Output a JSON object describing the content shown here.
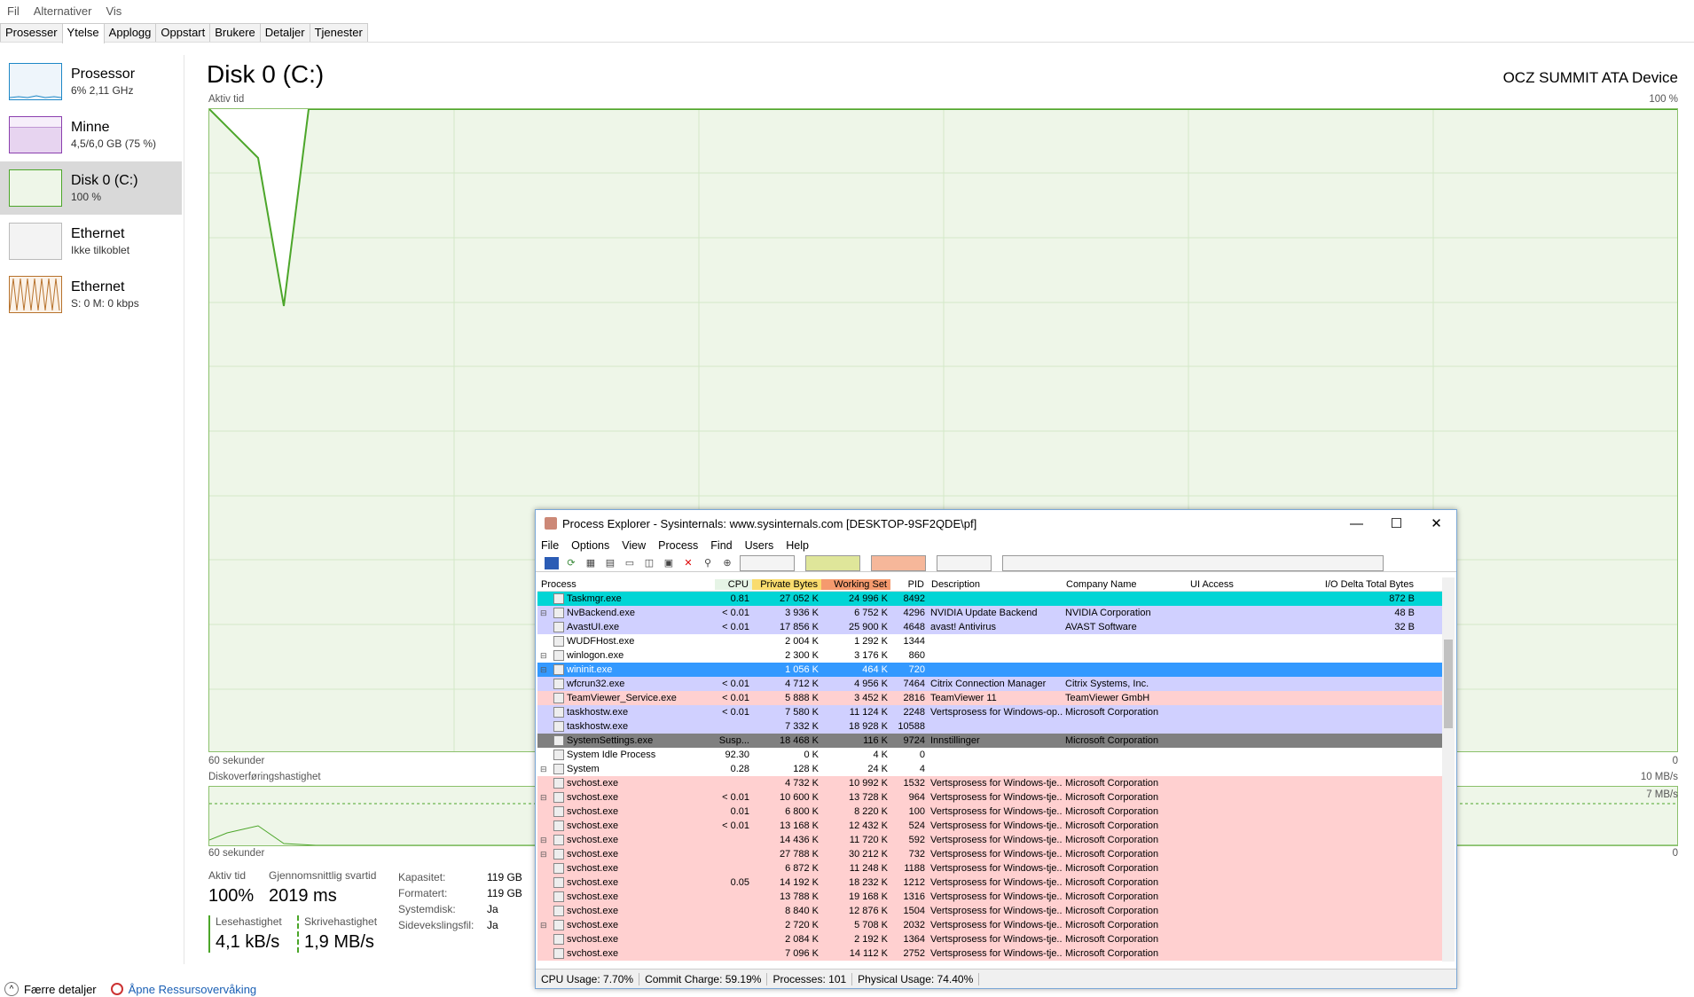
{
  "menubar": {
    "items": [
      "Fil",
      "Alternativer",
      "Vis"
    ]
  },
  "tabs": [
    "Prosesser",
    "Ytelse",
    "Applogg",
    "Oppstart",
    "Brukere",
    "Detaljer",
    "Tjenester"
  ],
  "sidebar": {
    "items": [
      {
        "name": "Prosessor",
        "sub": "6% 2,11 GHz",
        "color": "#1e88c7"
      },
      {
        "name": "Minne",
        "sub": "4,5/6,0 GB (75 %)",
        "color": "#8b3fae"
      },
      {
        "name": "Disk 0 (C:)",
        "sub": "100 %",
        "color": "#4ca62a"
      },
      {
        "name": "Ethernet",
        "sub": "Ikke tilkoblet",
        "color": "#aaaaaa"
      },
      {
        "name": "Ethernet",
        "sub": "S: 0 M: 0 kbps",
        "color": "#b7722c"
      }
    ]
  },
  "main": {
    "title": "Disk 0 (C:)",
    "device": "OCZ SUMMIT ATA Device",
    "graph1": {
      "label": "Aktiv tid",
      "max": "100 %",
      "time": "60 sekunder",
      "min": "0"
    },
    "graph2": {
      "label": "Diskoverføringshastighet",
      "max": "10 MB/s",
      "mid": "7 MB/s",
      "time": "60 sekunder",
      "min": "0"
    },
    "stats": {
      "active_label": "Aktiv tid",
      "active_value": "100%",
      "resp_label": "Gjennomsnittlig svartid",
      "resp_value": "2019 ms",
      "read_label": "Lesehastighet",
      "read_value": "4,1 kB/s",
      "write_label": "Skrivehastighet",
      "write_value": "1,9 MB/s",
      "props": [
        {
          "k": "Kapasitet:",
          "v": "119 GB"
        },
        {
          "k": "Formatert:",
          "v": "119 GB"
        },
        {
          "k": "Systemdisk:",
          "v": "Ja"
        },
        {
          "k": "Sidevekslingsfil:",
          "v": "Ja"
        }
      ]
    }
  },
  "footer": {
    "less": "Færre detaljer",
    "open": "Åpne Ressursovervåking"
  },
  "procexp": {
    "title": "Process Explorer - Sysinternals: www.sysinternals.com [DESKTOP-9SF2QDE\\pf]",
    "menu": [
      "File",
      "Options",
      "View",
      "Process",
      "Find",
      "Users",
      "Help"
    ],
    "columns": [
      "Process",
      "CPU",
      "Private Bytes",
      "Working Set",
      "PID",
      "Description",
      "Company Name",
      "UI Access",
      "I/O Delta Total Bytes"
    ],
    "rows": [
      {
        "tree": "",
        "name": "Taskmgr.exe",
        "cpu": "0.81",
        "pb": "27 052 K",
        "ws": "24 996 K",
        "pid": "8492",
        "desc": "",
        "comp": "",
        "io": "872 B",
        "bg": "#00d5d5"
      },
      {
        "tree": "⊟",
        "name": "NvBackend.exe",
        "cpu": "< 0.01",
        "pb": "3 936 K",
        "ws": "6 752 K",
        "pid": "4296",
        "desc": "NVIDIA Update Backend",
        "comp": "NVIDIA Corporation",
        "io": "48 B",
        "bg": "#d0d0ff"
      },
      {
        "tree": "",
        "name": "AvastUI.exe",
        "cpu": "< 0.01",
        "pb": "17 856 K",
        "ws": "25 900 K",
        "pid": "4648",
        "desc": "avast! Antivirus",
        "comp": "AVAST Software",
        "io": "32 B",
        "bg": "#d0d0ff"
      },
      {
        "tree": "",
        "name": "WUDFHost.exe",
        "cpu": "",
        "pb": "2 004 K",
        "ws": "1 292 K",
        "pid": "1344",
        "desc": "",
        "comp": "",
        "io": "",
        "bg": "#ffffff"
      },
      {
        "tree": "⊟",
        "name": "winlogon.exe",
        "cpu": "",
        "pb": "2 300 K",
        "ws": "3 176 K",
        "pid": "860",
        "desc": "",
        "comp": "",
        "io": "",
        "bg": "#ffffff"
      },
      {
        "tree": "⊟",
        "name": "wininit.exe",
        "cpu": "",
        "pb": "1 056 K",
        "ws": "464 K",
        "pid": "720",
        "desc": "",
        "comp": "",
        "io": "",
        "bg": "#3399ff",
        "fg": "#ffffff"
      },
      {
        "tree": "",
        "name": "wfcrun32.exe",
        "cpu": "< 0.01",
        "pb": "4 712 K",
        "ws": "4 956 K",
        "pid": "7464",
        "desc": "Citrix Connection Manager",
        "comp": "Citrix Systems, Inc.",
        "io": "",
        "bg": "#d0d0ff"
      },
      {
        "tree": "",
        "name": "TeamViewer_Service.exe",
        "cpu": "< 0.01",
        "pb": "5 888 K",
        "ws": "3 452 K",
        "pid": "2816",
        "desc": "TeamViewer 11",
        "comp": "TeamViewer GmbH",
        "io": "",
        "bg": "#ffd0d0"
      },
      {
        "tree": "",
        "name": "taskhostw.exe",
        "cpu": "< 0.01",
        "pb": "7 580 K",
        "ws": "11 124 K",
        "pid": "2248",
        "desc": "Vertsprosess for Windows-op...",
        "comp": "Microsoft Corporation",
        "io": "",
        "bg": "#d0d0ff"
      },
      {
        "tree": "",
        "name": "taskhostw.exe",
        "cpu": "",
        "pb": "7 332 K",
        "ws": "18 928 K",
        "pid": "10588",
        "desc": "",
        "comp": "",
        "io": "",
        "bg": "#d0d0ff"
      },
      {
        "tree": "",
        "name": "SystemSettings.exe",
        "cpu": "Susp...",
        "pb": "18 468 K",
        "ws": "116 K",
        "pid": "9724",
        "desc": "Innstillinger",
        "comp": "Microsoft Corporation",
        "io": "",
        "bg": "#808080"
      },
      {
        "tree": "",
        "name": "System Idle Process",
        "cpu": "92.30",
        "pb": "0 K",
        "ws": "4 K",
        "pid": "0",
        "desc": "",
        "comp": "",
        "io": "",
        "bg": "#ffffff"
      },
      {
        "tree": "⊟",
        "name": "System",
        "cpu": "0.28",
        "pb": "128 K",
        "ws": "24 K",
        "pid": "4",
        "desc": "",
        "comp": "",
        "io": "",
        "bg": "#ffffff"
      },
      {
        "tree": "",
        "name": "svchost.exe",
        "cpu": "",
        "pb": "4 732 K",
        "ws": "10 992 K",
        "pid": "1532",
        "desc": "Vertsprosess for Windows-tje...",
        "comp": "Microsoft Corporation",
        "io": "",
        "bg": "#ffd0d0"
      },
      {
        "tree": "⊟",
        "name": "svchost.exe",
        "cpu": "< 0.01",
        "pb": "10 600 K",
        "ws": "13 728 K",
        "pid": "964",
        "desc": "Vertsprosess for Windows-tje...",
        "comp": "Microsoft Corporation",
        "io": "",
        "bg": "#ffd0d0"
      },
      {
        "tree": "",
        "name": "svchost.exe",
        "cpu": "0.01",
        "pb": "6 800 K",
        "ws": "8 220 K",
        "pid": "100",
        "desc": "Vertsprosess for Windows-tje...",
        "comp": "Microsoft Corporation",
        "io": "",
        "bg": "#ffd0d0"
      },
      {
        "tree": "",
        "name": "svchost.exe",
        "cpu": "< 0.01",
        "pb": "13 168 K",
        "ws": "12 432 K",
        "pid": "524",
        "desc": "Vertsprosess for Windows-tje...",
        "comp": "Microsoft Corporation",
        "io": "",
        "bg": "#ffd0d0"
      },
      {
        "tree": "⊟",
        "name": "svchost.exe",
        "cpu": "",
        "pb": "14 436 K",
        "ws": "11 720 K",
        "pid": "592",
        "desc": "Vertsprosess for Windows-tje...",
        "comp": "Microsoft Corporation",
        "io": "",
        "bg": "#ffd0d0"
      },
      {
        "tree": "⊟",
        "name": "svchost.exe",
        "cpu": "",
        "pb": "27 788 K",
        "ws": "30 212 K",
        "pid": "732",
        "desc": "Vertsprosess for Windows-tje...",
        "comp": "Microsoft Corporation",
        "io": "",
        "bg": "#ffd0d0"
      },
      {
        "tree": "",
        "name": "svchost.exe",
        "cpu": "",
        "pb": "6 872 K",
        "ws": "11 248 K",
        "pid": "1188",
        "desc": "Vertsprosess for Windows-tje...",
        "comp": "Microsoft Corporation",
        "io": "",
        "bg": "#ffd0d0"
      },
      {
        "tree": "",
        "name": "svchost.exe",
        "cpu": "0.05",
        "pb": "14 192 K",
        "ws": "18 232 K",
        "pid": "1212",
        "desc": "Vertsprosess for Windows-tje...",
        "comp": "Microsoft Corporation",
        "io": "",
        "bg": "#ffd0d0"
      },
      {
        "tree": "",
        "name": "svchost.exe",
        "cpu": "",
        "pb": "13 788 K",
        "ws": "19 168 K",
        "pid": "1316",
        "desc": "Vertsprosess for Windows-tje...",
        "comp": "Microsoft Corporation",
        "io": "",
        "bg": "#ffd0d0"
      },
      {
        "tree": "",
        "name": "svchost.exe",
        "cpu": "",
        "pb": "8 840 K",
        "ws": "12 876 K",
        "pid": "1504",
        "desc": "Vertsprosess for Windows-tje...",
        "comp": "Microsoft Corporation",
        "io": "",
        "bg": "#ffd0d0"
      },
      {
        "tree": "⊟",
        "name": "svchost.exe",
        "cpu": "",
        "pb": "2 720 K",
        "ws": "5 708 K",
        "pid": "2032",
        "desc": "Vertsprosess for Windows-tje...",
        "comp": "Microsoft Corporation",
        "io": "",
        "bg": "#ffd0d0"
      },
      {
        "tree": "",
        "name": "svchost.exe",
        "cpu": "",
        "pb": "2 084 K",
        "ws": "2 192 K",
        "pid": "1364",
        "desc": "Vertsprosess for Windows-tje...",
        "comp": "Microsoft Corporation",
        "io": "",
        "bg": "#ffd0d0"
      },
      {
        "tree": "",
        "name": "svchost.exe",
        "cpu": "",
        "pb": "7 096 K",
        "ws": "14 112 K",
        "pid": "2752",
        "desc": "Vertsprosess for Windows-tje...",
        "comp": "Microsoft Corporation",
        "io": "",
        "bg": "#ffd0d0"
      }
    ],
    "status": [
      "CPU Usage: 7.70%",
      "Commit Charge: 59.19%",
      "Processes: 101",
      "Physical Usage: 74.40%"
    ]
  }
}
